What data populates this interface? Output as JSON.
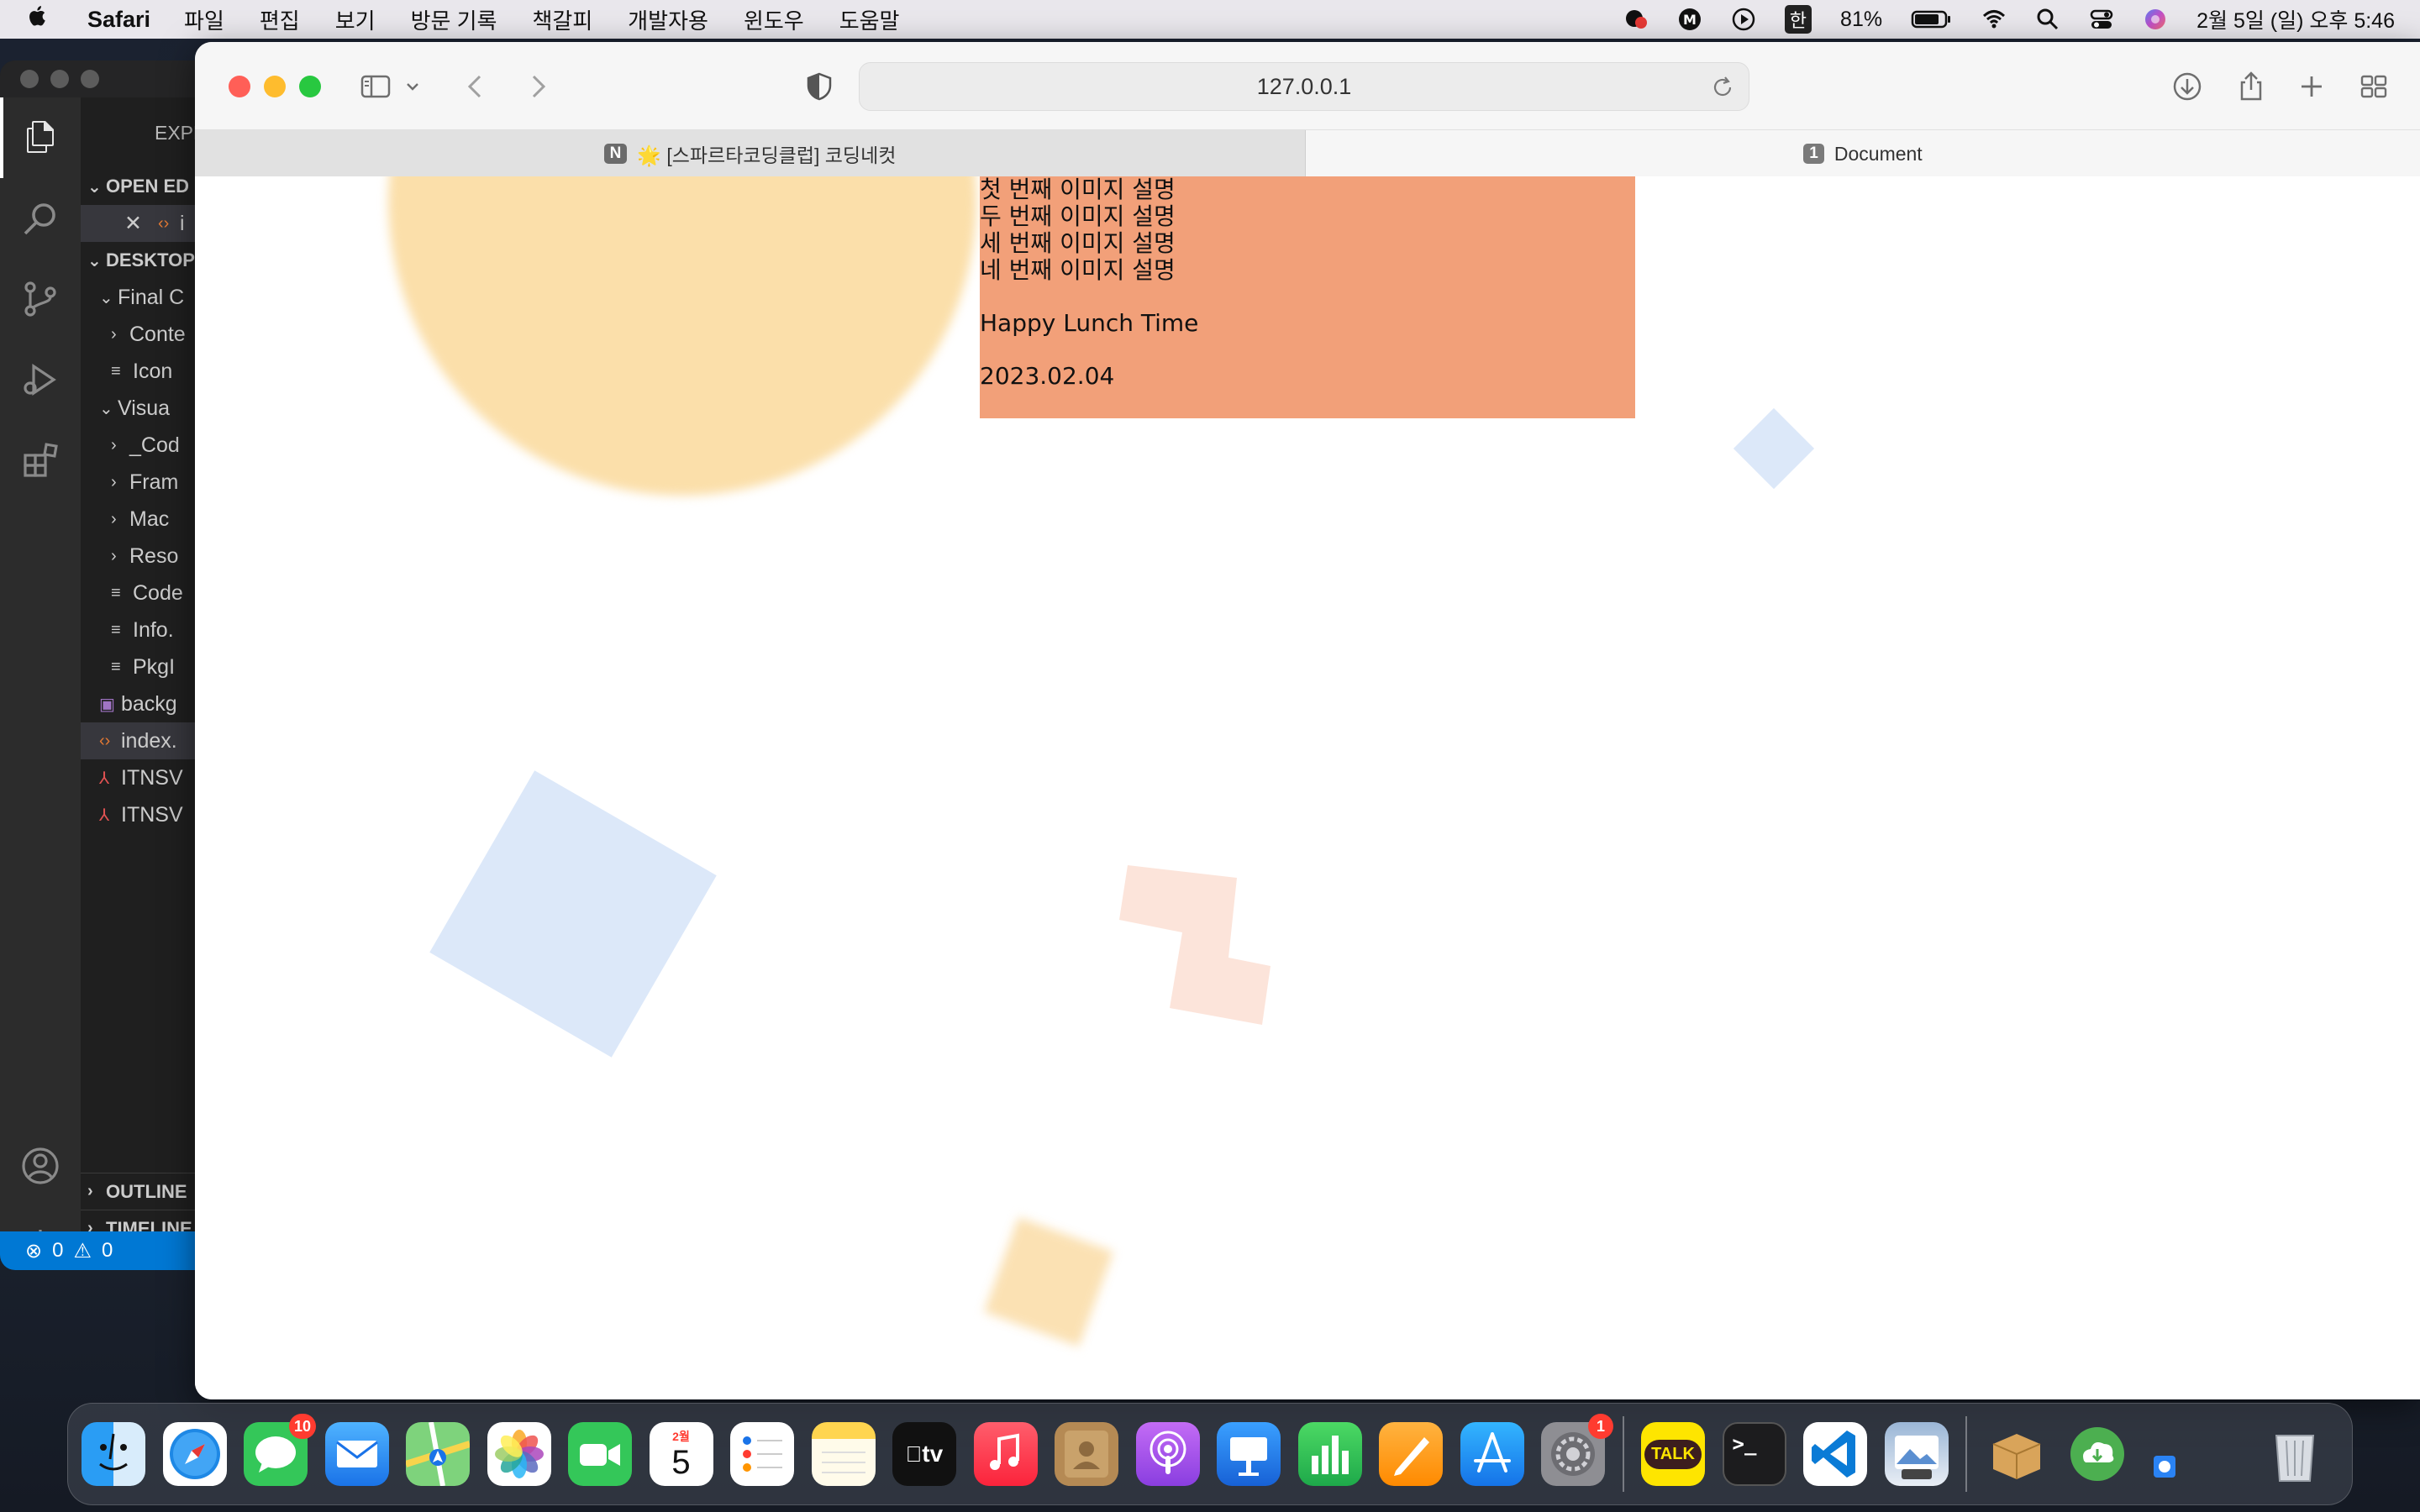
{
  "menubar": {
    "app_name": "Safari",
    "menus": [
      "파일",
      "편집",
      "보기",
      "방문 기록",
      "책갈피",
      "개발자용",
      "윈도우",
      "도움말"
    ],
    "ime_label": "한",
    "battery": "81%",
    "datetime": "2월 5일 (일) 오후 5:46"
  },
  "vscode": {
    "explorer_label": "EXPLORER",
    "open_editors_label": "OPEN ED",
    "open_file": "i",
    "desktop_label": "DESKTOP",
    "tree": [
      "Final C",
      "Conte",
      "Icon",
      "Visua",
      "_Cod",
      "Fram",
      "Mac",
      "Reso",
      "Code",
      "Info.",
      "PkgI",
      "backg",
      "index.",
      "ITNSV",
      "ITNSV"
    ],
    "outline_label": "OUTLINE",
    "timeline_label": "TIMELINE",
    "errors": "0",
    "warnings": "0"
  },
  "safari": {
    "url": "127.0.0.1",
    "tabs": [
      {
        "badge": "N",
        "label": "🌟 [스파르타코딩클럽] 코딩네컷"
      },
      {
        "badge": "1",
        "label": "Document"
      }
    ]
  },
  "page": {
    "captions": [
      "첫 번째 이미지 설명",
      "두 번째 이미지 설명",
      "세 번째 이미지 설명",
      "네 번째 이미지 설명"
    ],
    "title": "Happy Lunch Time",
    "date": "2023.02.04"
  },
  "dock": {
    "messages_badge": "10",
    "calendar_month": "2월",
    "calendar_day": "5",
    "settings_badge": "1",
    "kakao_label": "TALK",
    "tv_label": "tv"
  },
  "colors": {
    "content_box": "#f2a079",
    "circle": "#fbdfaa",
    "blue_shape": "#dce8f9",
    "peach_shape": "#fce4da"
  }
}
